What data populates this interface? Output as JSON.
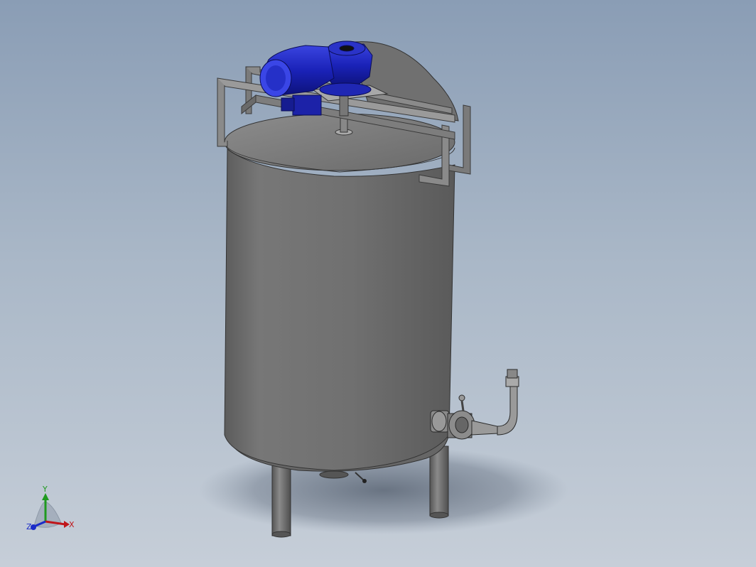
{
  "viewport": {
    "background_top": "#8a9db5",
    "background_bottom": "#c6ced8"
  },
  "model": {
    "tank_color": "#6f6f6f",
    "motor_color": "#1a1fb0",
    "frame_color": "#7a7a7a"
  },
  "triad": {
    "x_label": "X",
    "y_label": "Y",
    "z_label": "Z",
    "x_color": "#c0161b",
    "y_color": "#1f9a1f",
    "z_color": "#1b2cc8"
  }
}
